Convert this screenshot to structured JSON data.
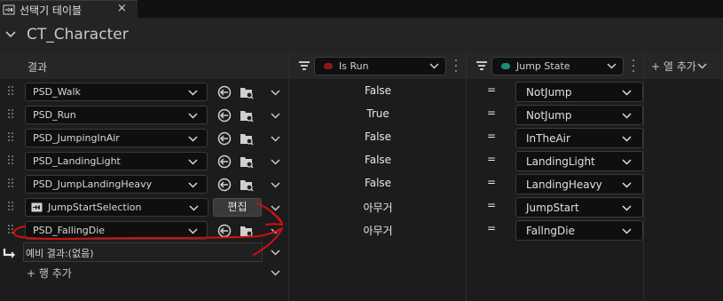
{
  "tab": {
    "title": "선택기 테이블",
    "close_glyph": "×",
    "icon": "selector-table-icon"
  },
  "asset": {
    "name": "CT_Character"
  },
  "header": {
    "results_label": "결과",
    "columns": [
      {
        "property": "Is Run",
        "dot_color": "#8b1a1a"
      },
      {
        "property": "Jump State",
        "dot_color": "#1d8a7a"
      }
    ],
    "add_column_label": "+ 열 추가"
  },
  "rows": [
    {
      "result": "PSD_Walk",
      "type": "asset",
      "is_run": "False",
      "op": "=",
      "jump_state": "NotJump"
    },
    {
      "result": "PSD_Run",
      "type": "asset",
      "is_run": "True",
      "op": "=",
      "jump_state": "NotJump"
    },
    {
      "result": "PSD_JumpingInAir",
      "type": "asset",
      "is_run": "False",
      "op": "=",
      "jump_state": "InTheAir"
    },
    {
      "result": "PSD_LandingLight",
      "type": "asset",
      "is_run": "False",
      "op": "=",
      "jump_state": "LandingLight"
    },
    {
      "result": "PSD_JumpLandingHeavy",
      "type": "asset",
      "is_run": "False",
      "op": "=",
      "jump_state": "LandingHeavy"
    },
    {
      "result": "JumpStartSelection",
      "type": "selector",
      "edit_label": "편집",
      "is_run": "아무거",
      "op": "=",
      "jump_state": "JumpStart"
    },
    {
      "result": "PSD_FallingDie",
      "type": "asset",
      "is_run": "아무거",
      "op": "=",
      "jump_state": "FallngDie"
    }
  ],
  "fallback": {
    "label": "예비 결과:(없음)"
  },
  "add_row_label": "+ 행 추가",
  "colors": {
    "background": "#1a1a1a",
    "annotation": "#d01010",
    "accent_is_run": "#8b1a1a",
    "accent_jump_state": "#1d8a7a"
  }
}
